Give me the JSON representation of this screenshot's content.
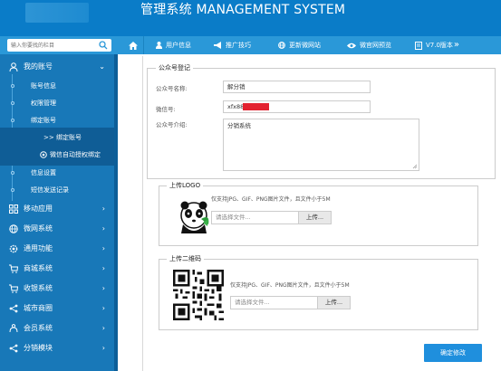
{
  "header": {
    "title": "管理系统 MANAGEMENT SYSTEM"
  },
  "search": {
    "placeholder": "输入你要找的栏目"
  },
  "nav": {
    "items": [
      {
        "label": "用户信息",
        "icon": "user-icon"
      },
      {
        "label": "推广技巧",
        "icon": "megaphone-icon"
      },
      {
        "label": "更新微网站",
        "icon": "globe-icon"
      },
      {
        "label": "微官网预览",
        "icon": "eye-icon"
      },
      {
        "label": "V7.0版本",
        "icon": "doc-icon"
      }
    ],
    "more": "»"
  },
  "sidebar": {
    "account": {
      "label": "我的账号",
      "arrow": "⌄"
    },
    "sub_items": [
      {
        "label": "账号信息"
      },
      {
        "label": "权限管理"
      },
      {
        "label": "绑定账号"
      },
      {
        "label": ">> 绑定账号"
      },
      {
        "label": "微信自动授权绑定"
      },
      {
        "label": "信息设置"
      },
      {
        "label": "短信发送记录"
      }
    ],
    "sections": [
      {
        "label": "移动应用"
      },
      {
        "label": "微网系统"
      },
      {
        "label": "通用功能"
      },
      {
        "label": "商城系统"
      },
      {
        "label": "收银系统"
      },
      {
        "label": "城市商圈"
      },
      {
        "label": "会员系统"
      },
      {
        "label": "分销模块"
      }
    ],
    "arrow": "›"
  },
  "form": {
    "section_title": "公众号登记",
    "name_label": "公众号名称:",
    "name_value": "解分销",
    "wechat_label": "微信号:",
    "wechat_value": "xfx88",
    "intro_label": "公众号介绍:",
    "intro_value": "分销系统",
    "logo_title": "上传LOGO",
    "logo_note": "仅支持JPG、GIF、PNG图片文件，且文件小于5M",
    "logo_file_placeholder": "请选择文件...",
    "logo_upload_btn": "上传...",
    "qr_title": "上传二维码",
    "qr_note": "仅支持JPG、GIF、PNG图片文件，且文件小于5M",
    "qr_file_placeholder": "请选择文件...",
    "qr_upload_btn": "上传...",
    "save_label": "确定修改"
  },
  "colors": {
    "header": "#0a7cc8",
    "nav": "#2a98d8",
    "sidebar": "#1878b8",
    "accent": "#1f8fdd",
    "redact": "#e32230"
  }
}
